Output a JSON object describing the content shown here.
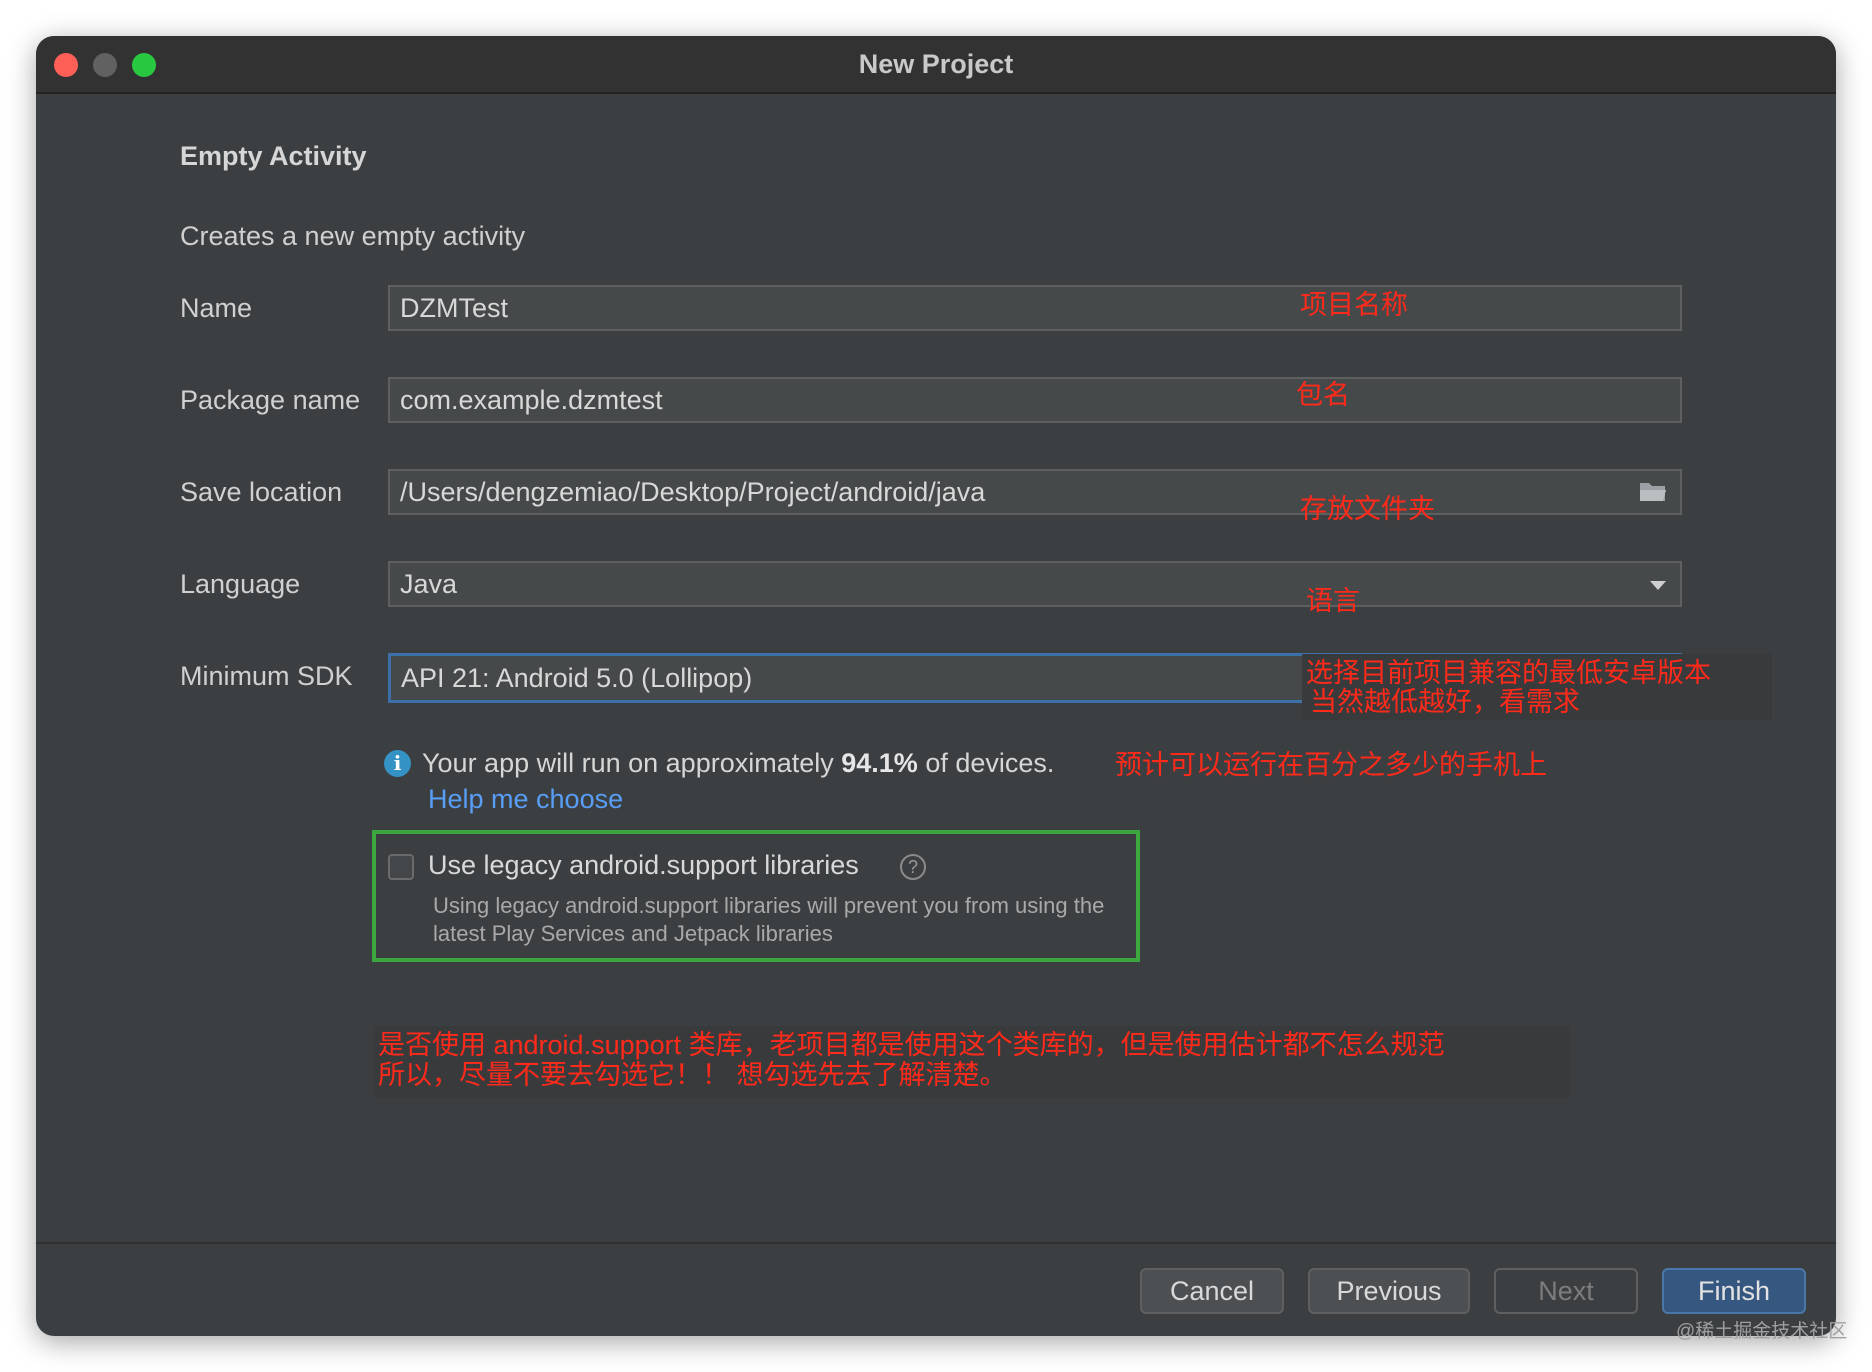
{
  "window": {
    "title": "New Project"
  },
  "header": {
    "title": "Empty Activity",
    "subtitle": "Creates a new empty activity"
  },
  "form": {
    "name": {
      "label": "Name",
      "value": "DZMTest",
      "annotation": "项目名称"
    },
    "package": {
      "label": "Package name",
      "value": "com.example.dzmtest",
      "annotation": "包名"
    },
    "save_location": {
      "label": "Save location",
      "value": "/Users/dengzemiao/Desktop/Project/android/java",
      "annotation": "存放文件夹"
    },
    "language": {
      "label": "Language",
      "value": "Java",
      "annotation": "语言"
    },
    "min_sdk": {
      "label": "Minimum SDK",
      "value": "API 21: Android 5.0 (Lollipop)",
      "annotation_line1": "选择目前项目兼容的最低安卓版本",
      "annotation_line2": "当然越低越好，看需求"
    }
  },
  "info": {
    "text_before": "Your app will run on approximately ",
    "percent": "94.1%",
    "text_after": " of devices.",
    "annotation": "预计可以运行在百分之多少的手机上",
    "help_link": "Help me choose"
  },
  "legacy": {
    "label": "Use legacy android.support libraries",
    "help_icon": "?",
    "description": "Using legacy android.support libraries will prevent you from using the latest Play Services and Jetpack libraries",
    "annotation_line1": "是否使用 android.support 类库，老项目都是使用这个类库的，但是使用估计都不怎么规范",
    "annotation_line2": "所以，尽量不要去勾选它！！ 想勾选先去了解清楚。"
  },
  "buttons": {
    "cancel": "Cancel",
    "previous": "Previous",
    "next": "Next",
    "finish": "Finish"
  },
  "watermark": "@稀土掘金技术社区",
  "colors": {
    "annotation": "#ff2a1a",
    "highlight_box": "#3aa83e",
    "link": "#589df6",
    "primary_button": "#365880"
  }
}
